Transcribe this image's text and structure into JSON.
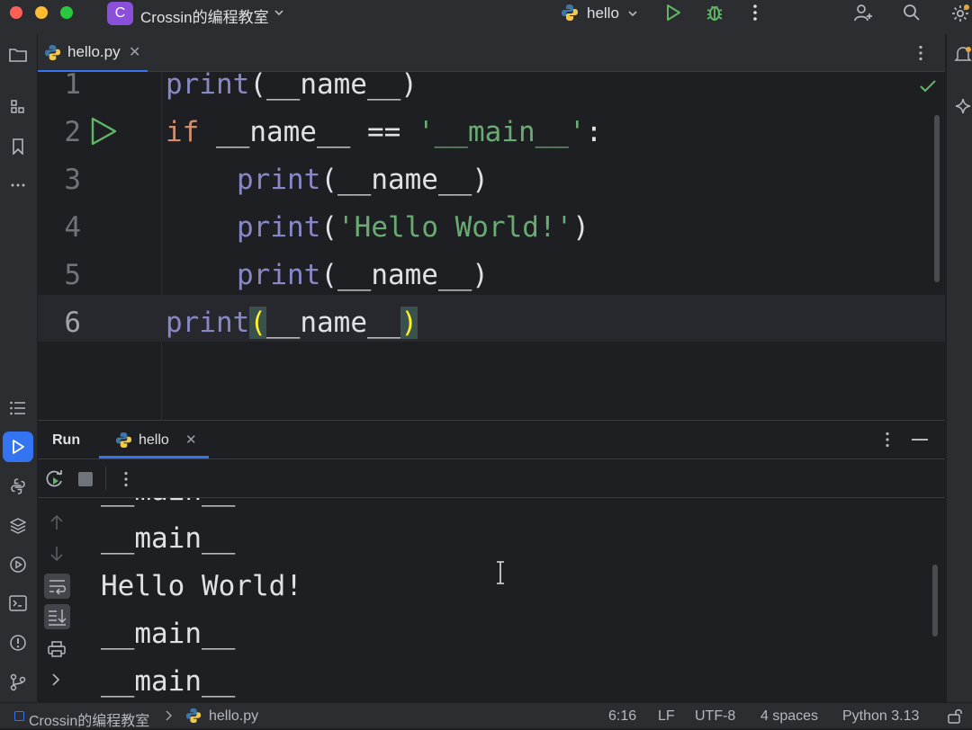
{
  "titlebar": {
    "project_badge": "C",
    "project_name": "Crossin的编程教室",
    "run_config": "hello"
  },
  "editor": {
    "tab": {
      "label": "hello.py"
    },
    "lines": [
      {
        "num": "1"
      },
      {
        "num": "2"
      },
      {
        "num": "3"
      },
      {
        "num": "4"
      },
      {
        "num": "5"
      },
      {
        "num": "6"
      }
    ],
    "code": {
      "l1_fn": "print",
      "l1_args": "(__name__)",
      "l2_kw": "if",
      "l2_rest": " __name__ == ",
      "l2_str": "'__main__'",
      "l2_colon": ":",
      "l3_fn": "print",
      "l3_args": "(__name__)",
      "l4_fn": "print",
      "l4_open": "(",
      "l4_str": "'Hello World!'",
      "l4_close": ")",
      "l5_fn": "print",
      "l5_args": "(__name__)",
      "l6_fn": "print",
      "l6_open": "(",
      "l6_mid": "__name__",
      "l6_close": ")"
    }
  },
  "run_panel": {
    "title": "Run",
    "tab_label": "hello",
    "output": [
      "__main__",
      "__main__",
      "Hello World!",
      "__main__",
      "__main__"
    ]
  },
  "statusbar": {
    "project": "Crossin的编程教室",
    "file": "hello.py",
    "position": "6:16",
    "line_sep": "LF",
    "encoding": "UTF-8",
    "indent": "4 spaces",
    "interpreter": "Python 3.13"
  },
  "colors": {
    "accent": "#3574f0",
    "keyword": "#cf8e6d",
    "string": "#6aab73",
    "builtin": "#8888c6",
    "run_green": "#5fb865"
  }
}
